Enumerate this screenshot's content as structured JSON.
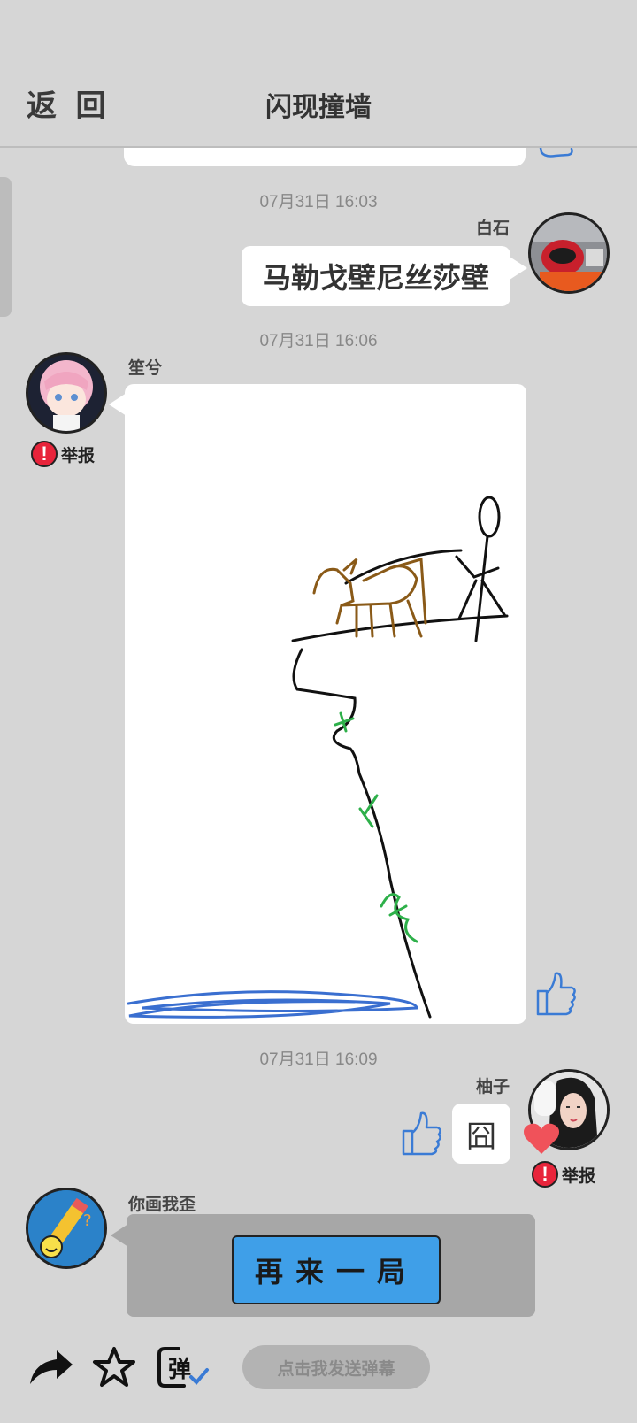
{
  "header": {
    "back_label": "返 回",
    "title": "闪现撞墙"
  },
  "messages": [
    {
      "time": "07月31日  16:03",
      "name": "白石",
      "text": "马勒戈壁尼丝莎壁"
    },
    {
      "time": "07月31日  16:06",
      "name": "笙兮",
      "report_label": "举报"
    },
    {
      "time": "07月31日  16:09",
      "name": "柚子",
      "text": "囧",
      "report_label": "举报"
    },
    {
      "name": "你画我歪",
      "button_label": "再来一局"
    }
  ],
  "bottom_bar": {
    "danmu_placeholder": "点击我发送弹幕",
    "danmu_icon_char": "弹"
  },
  "colors": {
    "accent_blue": "#3f9fe8",
    "report_red": "#e8243b",
    "thumb_blue": "#3a7bd5",
    "heart_red": "#f0525a"
  },
  "icons": [
    "share-icon",
    "star-icon",
    "danmu-icon",
    "thumbs-up-icon",
    "heart-icon",
    "report-icon"
  ]
}
